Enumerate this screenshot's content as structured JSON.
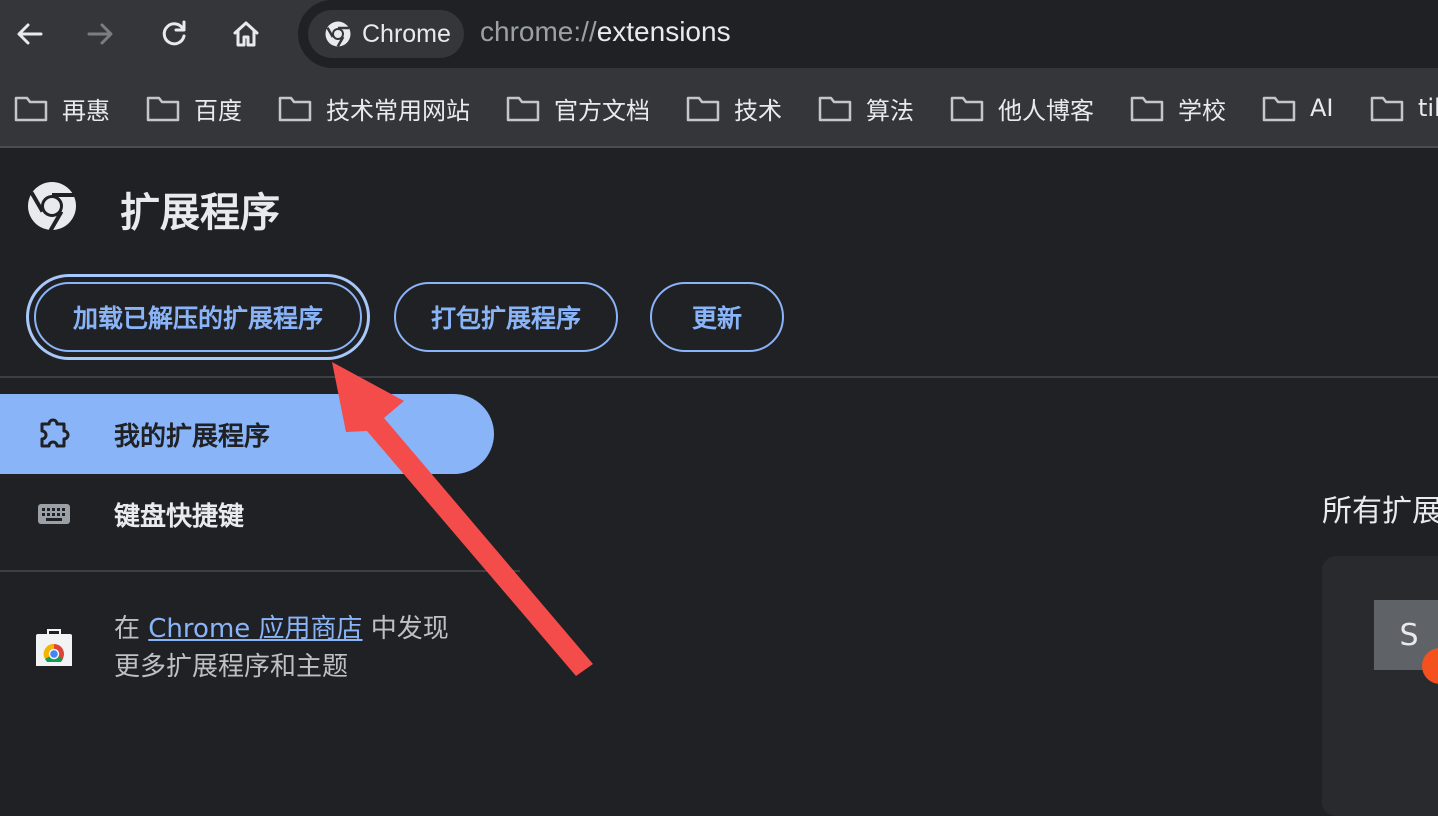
{
  "browser": {
    "chip_label": "Chrome",
    "url_scheme": "chrome://",
    "url_path": "extensions"
  },
  "bookmarks": [
    "再惠",
    "百度",
    "技术常用网站",
    "官方文档",
    "技术",
    "算法",
    "他人博客",
    "学校",
    "AI",
    "tik"
  ],
  "header": {
    "title": "扩展程序"
  },
  "actions": {
    "load_unpacked": "加载已解压的扩展程序",
    "pack": "打包扩展程序",
    "update": "更新"
  },
  "sidebar": {
    "items": [
      {
        "label": "我的扩展程序",
        "icon": "puzzle-icon",
        "active": true
      },
      {
        "label": "键盘快捷键",
        "icon": "keyboard-icon",
        "active": false
      }
    ],
    "store_prefix": "在",
    "store_link": "Chrome 应用商店",
    "store_suffix": "中发现",
    "store_line2": "更多扩展程序和主题"
  },
  "main": {
    "section_title": "所有扩展",
    "card_initial": "S"
  },
  "annotation": {
    "arrow_color": "#f44b4b"
  },
  "colors": {
    "accent": "#8ab4f8",
    "toolbar": "#35363a",
    "page_bg": "#202124"
  }
}
